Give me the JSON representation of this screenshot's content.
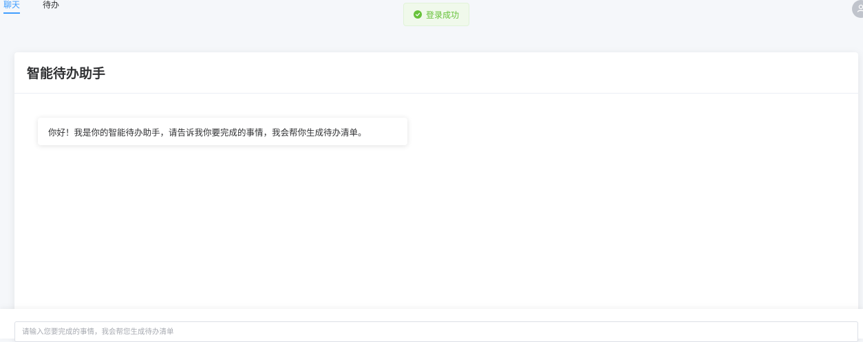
{
  "nav": {
    "tabs": [
      {
        "label": "聊天",
        "active": true
      },
      {
        "label": "待办",
        "active": false
      }
    ]
  },
  "toast": {
    "text": "登录成功",
    "icon": "check-circle-icon",
    "color": "#67c23a"
  },
  "user": {
    "avatar_icon": "user-icon"
  },
  "chat": {
    "title": "智能待办助手",
    "messages": [
      {
        "role": "assistant",
        "text": "你好！我是你的智能待办助手，请告诉我你要完成的事情，我会帮你生成待办清单。"
      }
    ]
  },
  "composer": {
    "placeholder": "请输入您要完成的事情，我会帮您生成待办清单",
    "value": ""
  },
  "colors": {
    "accent": "#409eff",
    "success": "#67c23a"
  }
}
